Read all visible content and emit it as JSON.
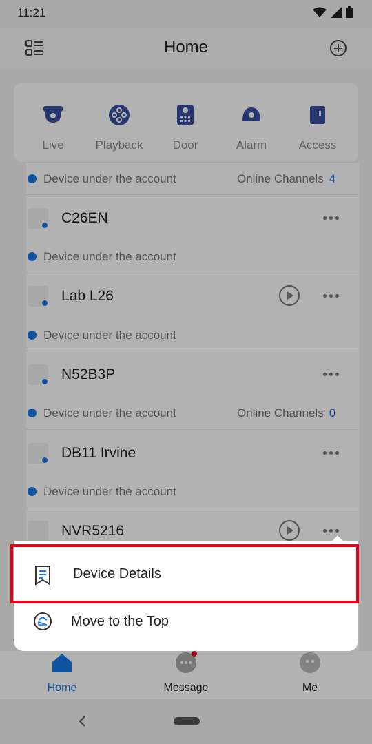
{
  "status": {
    "time": "11:21"
  },
  "header": {
    "title": "Home"
  },
  "quick_actions": [
    {
      "label": "Live",
      "icon": "camera-icon"
    },
    {
      "label": "Playback",
      "icon": "playback-icon"
    },
    {
      "label": "Door",
      "icon": "door-icon"
    },
    {
      "label": "Alarm",
      "icon": "alarm-icon"
    },
    {
      "label": "Access",
      "icon": "access-icon"
    }
  ],
  "devices": {
    "partial_sub": {
      "text": "Device under the account",
      "online_label": "Online Channels",
      "online_count": "4"
    },
    "items": [
      {
        "name": "C26EN",
        "sub": "Device under the account"
      },
      {
        "name": "Lab L26",
        "sub": "Device under the account"
      },
      {
        "name": "N52B3P",
        "sub": "Device under the account",
        "online_label": "Online Channels",
        "online_count": "0"
      },
      {
        "name": "DB11 Irvine",
        "sub": "Device under the account"
      },
      {
        "name": "NVR5216"
      }
    ]
  },
  "popup_menu": {
    "items": [
      {
        "label": "Device Details",
        "icon": "document-icon"
      },
      {
        "label": "Move to the Top",
        "icon": "move-to-top-icon"
      }
    ]
  },
  "bottom_nav": [
    {
      "label": "Home",
      "icon": "home-icon",
      "active": true
    },
    {
      "label": "Message",
      "icon": "message-icon"
    },
    {
      "label": "Me",
      "icon": "profile-icon"
    }
  ],
  "colors": {
    "accent": "#1677e6",
    "highlight": "#e6001a",
    "quick_icon": "#3a4fa0"
  }
}
